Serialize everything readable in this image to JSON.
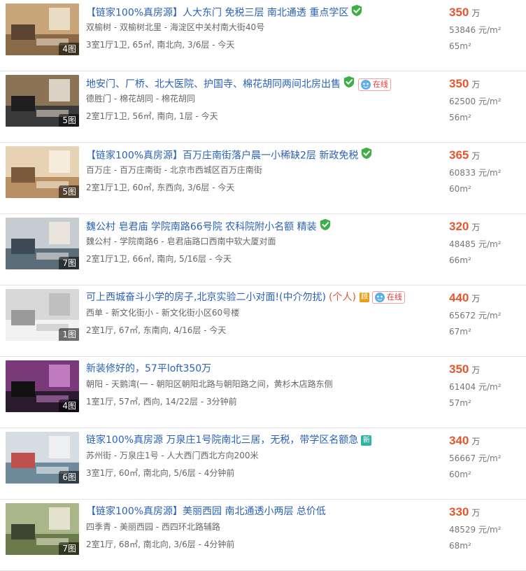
{
  "listings": [
    {
      "title": "【链家100%真房源】人大东门 免税三层 南北通透 重点学区",
      "tags": [
        "verified"
      ],
      "location": "双榆树 - 双榆树北里 - 海淀区中关村南大街40号",
      "info": "3室1厅1卫, 65㎡, 南北向, 3/6层 - 今天",
      "price": "350",
      "price_unit": "万",
      "unit_price": "53846",
      "unit_price_unit": "元/m²",
      "area": "65m²",
      "photo_count": "4图"
    },
    {
      "title": "地安门、厂桥、北大医院、护国寺、棉花胡同两间北房出售",
      "tags": [
        "verified",
        "online"
      ],
      "location": "德胜门 - 棉花胡同 - 棉花胡同",
      "info": "2室1厅1卫, 56㎡, 南向, 1层 - 今天",
      "price": "350",
      "price_unit": "万",
      "unit_price": "62500",
      "unit_price_unit": "元/m²",
      "area": "56m²",
      "photo_count": "5图"
    },
    {
      "title": "【链家100%真房源】百万庄南街落户晨一小稀缺2层 新政免税",
      "tags": [
        "verified"
      ],
      "location": "百万庄 - 百万庄南街 - 北京市西城区百万庄南街",
      "info": "2室1厅1卫, 60㎡, 东西向, 3/6层 - 今天",
      "price": "365",
      "price_unit": "万",
      "unit_price": "60833",
      "unit_price_unit": "元/m²",
      "area": "60m²",
      "photo_count": "5图"
    },
    {
      "title": "魏公村 皂君庙 学院南路66号院 农科院附小名额 精装",
      "tags": [
        "verified"
      ],
      "location": "魏公村 - 学院南路6 - 皂君庙路口西南中软大厦对面",
      "info": "2室1厅1卫, 66㎡, 南向, 5/16层 - 今天",
      "price": "320",
      "price_unit": "万",
      "unit_price": "48485",
      "unit_price_unit": "元/m²",
      "area": "66m²",
      "photo_count": "7图"
    },
    {
      "title": "可上西城奋斗小学的房子,北京实验二小对面!(中介勿扰)",
      "personal": "(个人)",
      "tags": [
        "gu",
        "online"
      ],
      "location": "西单 - 新文化街小 - 新文化街小区60号楼",
      "info": "2室1厅, 67㎡, 东南向, 4/16层 - 今天",
      "price": "440",
      "price_unit": "万",
      "unit_price": "65672",
      "unit_price_unit": "元/m²",
      "area": "67m²",
      "photo_count": "1图"
    },
    {
      "title": "新装修好的，57平loft350万",
      "tags": [],
      "location": "朝阳 - 天鹅湾(一 - 朝阳区朝阳北路与朝阳路之间，黄杉木店路东侧",
      "info": "1室1厅, 57㎡, 西向, 14/22层 - 3分钟前",
      "price": "350",
      "price_unit": "万",
      "unit_price": "61404",
      "unit_price_unit": "元/m²",
      "area": "57m²",
      "photo_count": "4图"
    },
    {
      "title": "链家100%真房源 万泉庄1号院南北三居，无税，带学区名额急",
      "tags": [
        "new"
      ],
      "location": "苏州街 - 万泉庄1号 - 人大西门西北方向200米",
      "info": "3室1厅, 60㎡, 南北向, 5/6层 - 4分钟前",
      "price": "340",
      "price_unit": "万",
      "unit_price": "56667",
      "unit_price_unit": "元/m²",
      "area": "60m²",
      "photo_count": "6图"
    },
    {
      "title": "【链家100%真房源】美丽西园 南北通透小两层 总价低",
      "tags": [],
      "location": "四季青 - 美丽西园 - 西四环北路辅路",
      "info": "2室1厅, 68㎡, 南北向, 3/6层 - 4分钟前",
      "price": "330",
      "price_unit": "万",
      "unit_price": "48529",
      "unit_price_unit": "元/m²",
      "area": "68m²",
      "photo_count": "7图"
    }
  ],
  "labels": {
    "online": "在线",
    "gu": "顾",
    "new": "新"
  },
  "colors": {
    "title_link": "#2a62b8",
    "price": "#e4572e",
    "verified": "#3fae49"
  },
  "icons": {
    "verified": "shield-check-icon",
    "online": "online-chat-icon"
  }
}
